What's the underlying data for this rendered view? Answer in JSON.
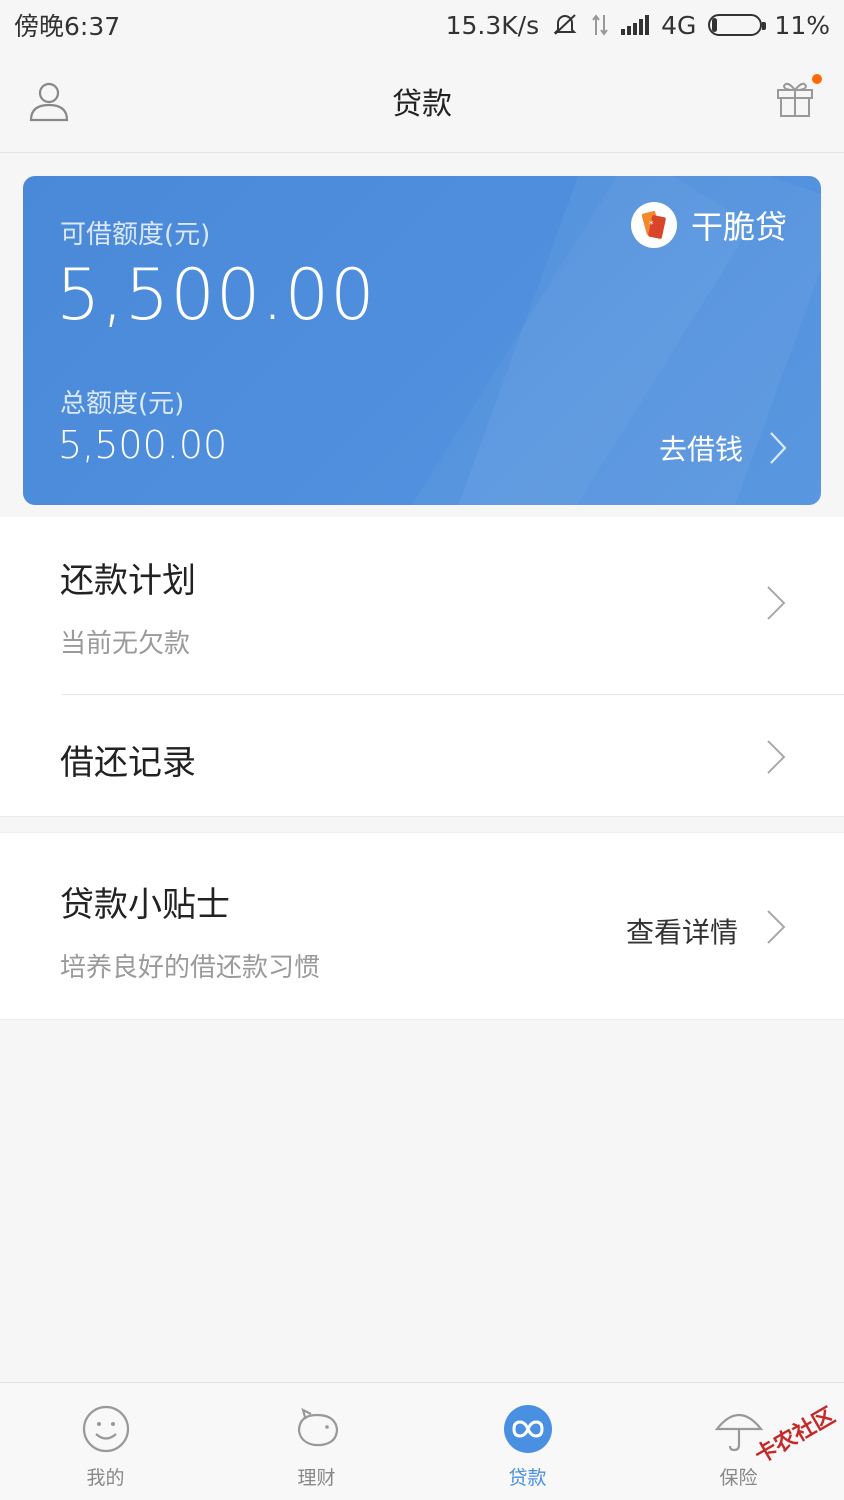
{
  "status_bar": {
    "time": "傍晚6:37",
    "speed": "15.3K/s",
    "network": "4G",
    "battery": "11%",
    "battery_level": 0.11
  },
  "header": {
    "title": "贷款",
    "left_icon": "user-icon",
    "right_icon": "gift-icon"
  },
  "card": {
    "available_label": "可借额度(元)",
    "available_amount": "5,500.00",
    "total_label": "总额度(元)",
    "total_amount": "5,500.00",
    "brand_name": "干脆贷",
    "borrow_label": "去借钱"
  },
  "list": {
    "repay_plan": {
      "title": "还款计划",
      "subtitle": "当前无欠款"
    },
    "records": {
      "title": "借还记录"
    },
    "tips": {
      "title": "贷款小贴士",
      "subtitle": "培养良好的借还款习惯",
      "action": "查看详情"
    }
  },
  "nav": {
    "items": [
      {
        "label": "我的",
        "icon": "smile-icon"
      },
      {
        "label": "理财",
        "icon": "piggy-bank-icon"
      },
      {
        "label": "贷款",
        "icon": "loan-infinity-icon"
      },
      {
        "label": "保险",
        "icon": "umbrella-icon"
      }
    ]
  },
  "watermark": "卡农社区",
  "colors": {
    "accent": "#4a90e2",
    "card": "#4f8fdd",
    "badge": "#ff6a00"
  }
}
